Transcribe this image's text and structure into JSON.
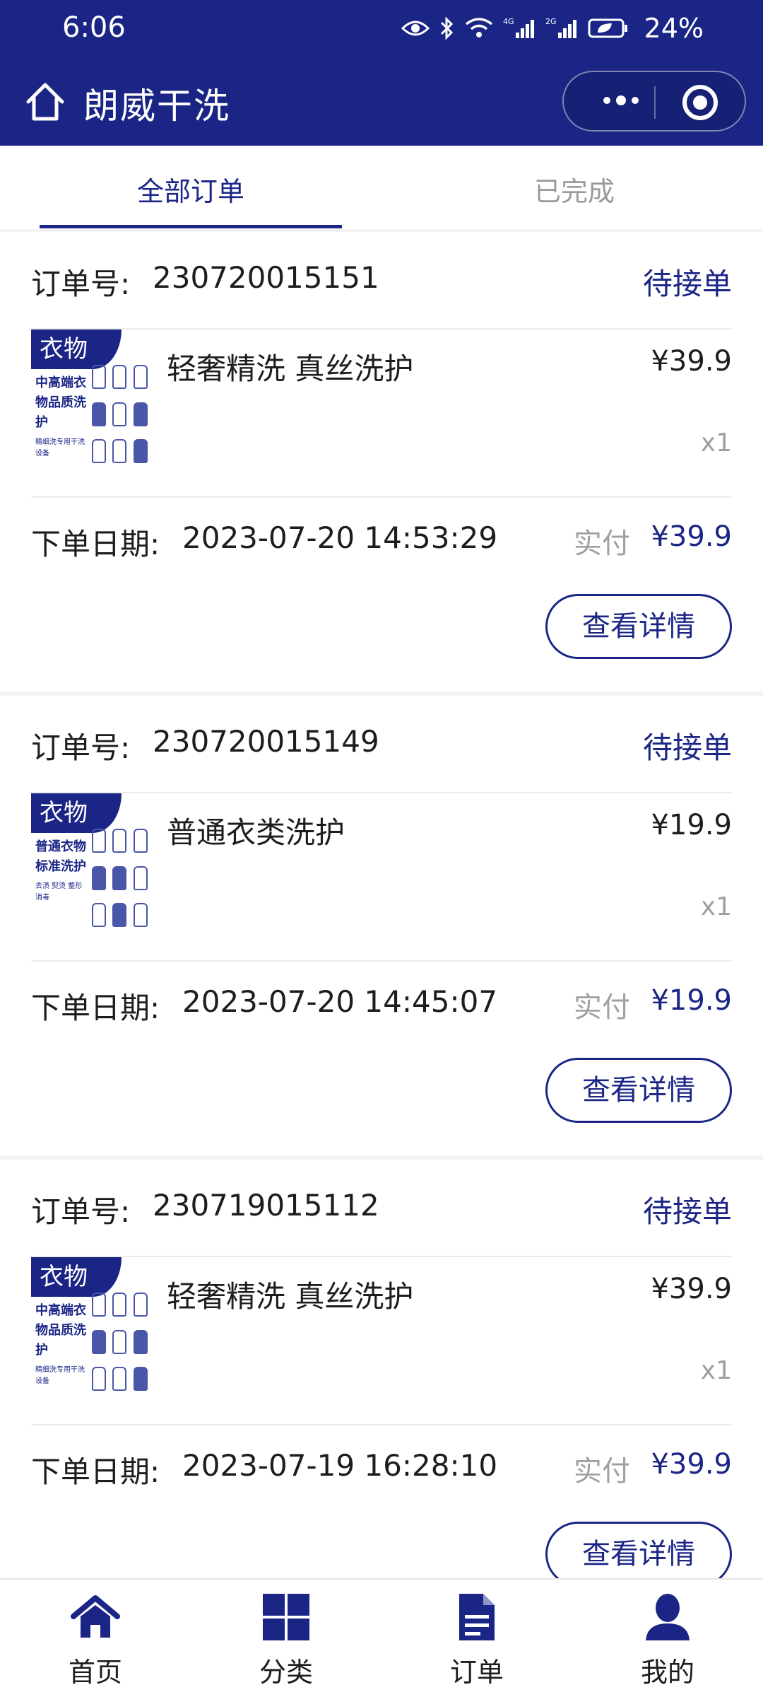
{
  "status_bar": {
    "time": "6:06",
    "battery": "24%",
    "icons": [
      "eye-icon",
      "bluetooth-icon",
      "wifi-icon",
      "signal-4g-icon",
      "signal-2g-icon",
      "battery-icon"
    ]
  },
  "header": {
    "title": "朗威干洗",
    "bg_color": "#1a2586"
  },
  "tabs": [
    {
      "label": "全部订单",
      "active": true
    },
    {
      "label": "已完成",
      "active": false
    }
  ],
  "labels": {
    "order_no": "订单号:",
    "order_date": "下单日期:",
    "paid": "实付",
    "detail_button": "查看详情",
    "thumb_tag": "衣物"
  },
  "orders": [
    {
      "order_no": "230720015151",
      "status": "待接单",
      "item_name": "轻奢精洗 真丝洗护",
      "promo_title": "中高端衣物品质洗护",
      "promo_sub": "精细洗专用干洗设备",
      "price": "¥39.9",
      "qty": "x1",
      "date": "2023-07-20 14:53:29",
      "paid": "¥39.9"
    },
    {
      "order_no": "230720015149",
      "status": "待接单",
      "item_name": "普通衣类洗护",
      "promo_title": "普通衣物标准洗护",
      "promo_sub": "去渍 熨烫 整形 消毒",
      "price": "¥19.9",
      "qty": "x1",
      "date": "2023-07-20 14:45:07",
      "paid": "¥19.9"
    },
    {
      "order_no": "230719015112",
      "status": "待接单",
      "item_name": "轻奢精洗 真丝洗护",
      "promo_title": "中高端衣物品质洗护",
      "promo_sub": "精细洗专用干洗设备",
      "price": "¥39.9",
      "qty": "x1",
      "date": "2023-07-19 16:28:10",
      "paid": "¥39.9"
    }
  ],
  "bottom_nav": [
    {
      "label": "首页",
      "icon": "home-icon"
    },
    {
      "label": "分类",
      "icon": "grid-icon"
    },
    {
      "label": "订单",
      "icon": "document-icon"
    },
    {
      "label": "我的",
      "icon": "user-icon"
    }
  ]
}
